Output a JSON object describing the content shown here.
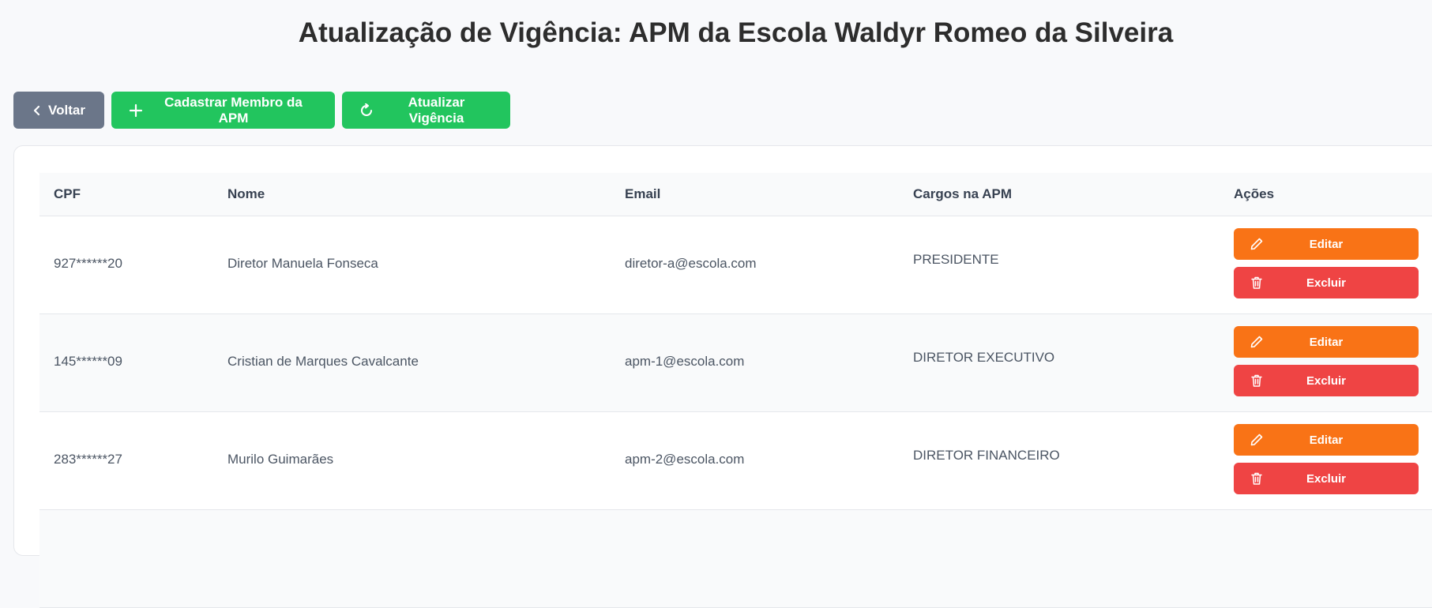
{
  "page": {
    "title": "Atualização de Vigência: APM da Escola Waldyr Romeo da Silveira"
  },
  "toolbar": {
    "back_label": "Voltar",
    "add_label": "Cadastrar Membro da APM",
    "refresh_label": "Atualizar Vigência",
    "back_icon": "chevron-left-icon",
    "add_icon": "plus-icon",
    "refresh_icon": "refresh-icon"
  },
  "table": {
    "columns": [
      "CPF",
      "Nome",
      "Email",
      "Cargos na APM",
      "Ações"
    ],
    "rows": [
      {
        "cpf": "927******20",
        "nome": "Diretor Manuela Fonseca",
        "email": "diretor-a@escola.com",
        "cargo": "PRESIDENTE",
        "edit_label": "Editar",
        "delete_label": "Excluir"
      },
      {
        "cpf": "145******09",
        "nome": "Cristian de Marques Cavalcante",
        "email": "apm-1@escola.com",
        "cargo": "DIRETOR EXECUTIVO",
        "edit_label": "Editar",
        "delete_label": "Excluir"
      },
      {
        "cpf": "283******27",
        "nome": "Murilo Guimarães",
        "email": "apm-2@escola.com",
        "cargo": "DIRETOR FINANCEIRO",
        "edit_label": "Editar",
        "delete_label": "Excluir"
      }
    ]
  },
  "colors": {
    "back_button": "#6b7689",
    "success": "#22c55e",
    "edit": "#f97316",
    "delete": "#ef4444"
  }
}
